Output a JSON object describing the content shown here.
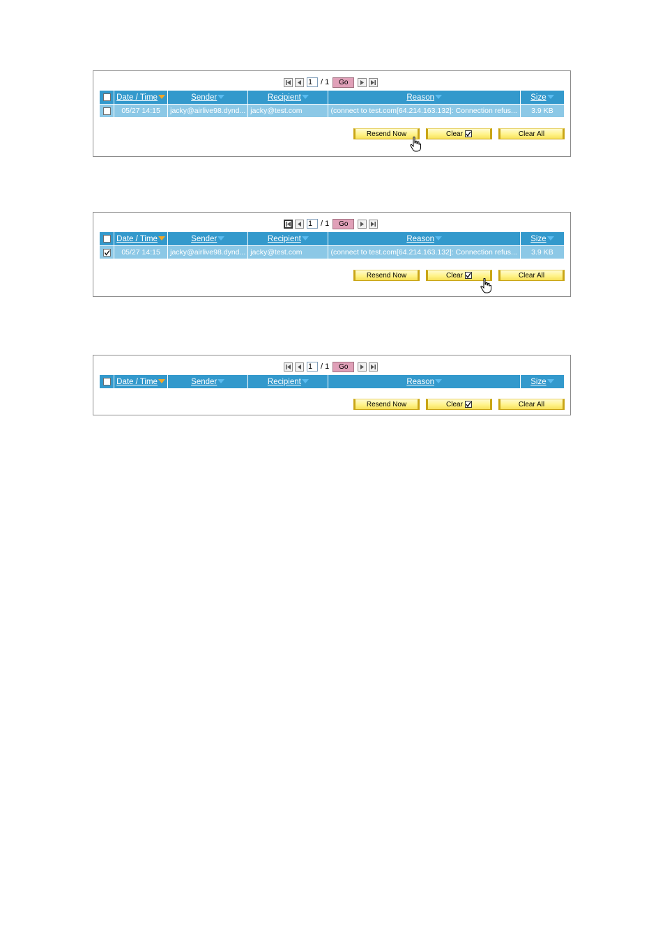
{
  "pager": {
    "page": "1",
    "total": "/ 1",
    "go": "Go"
  },
  "columns": {
    "date": "Date / Time",
    "sender": "Sender",
    "recipient": "Recipient",
    "reason": "Reason",
    "size": "Size"
  },
  "row": {
    "datetime": "05/27 14:15",
    "sender": "jacky@airlive98.dynd...",
    "recipient": "jacky@test.com",
    "reason": "(connect to test.com[64.214.163.132]: Connection refus...",
    "size": "3.9 KB"
  },
  "buttons": {
    "resend": "Resend Now",
    "clear": "Clear",
    "clear_all": "Clear All"
  },
  "panels": [
    {
      "has_row": true,
      "row_checked": false
    },
    {
      "has_row": true,
      "row_checked": true
    },
    {
      "has_row": false
    }
  ],
  "colors": {
    "header": "#3399cc",
    "row": "#8cc8e6",
    "sort_active": "#f5a623",
    "sort_inactive": "#5bbcf0",
    "button": "#fff38a",
    "go": "#e0a0b8"
  }
}
